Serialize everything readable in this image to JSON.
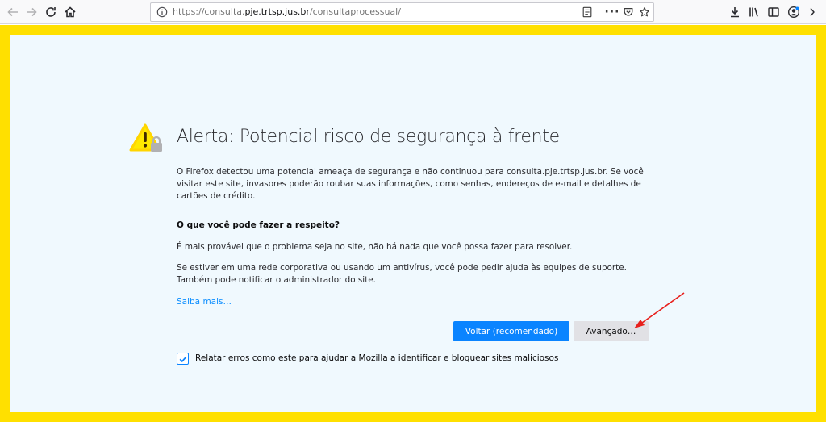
{
  "browser": {
    "url_prefix": "https://consulta.",
    "url_host": "pje.trtsp.jus.br",
    "url_path": "/consultaprocessual/",
    "icons": {
      "back": "arrow-left-icon",
      "forward": "arrow-right-icon",
      "reload": "reload-icon",
      "home": "home-icon",
      "info": "info-icon",
      "reader": "reader-view-icon",
      "more": "more-icon",
      "pocket": "pocket-icon",
      "bookmark": "star-icon",
      "downloads": "download-icon",
      "library": "library-icon",
      "sidebar": "sidebar-icon",
      "account": "account-icon"
    }
  },
  "error_page": {
    "title": "Alerta: Potencial risco de segurança à frente",
    "intro": "O Firefox detectou uma potencial ameaça de segurança e não continuou para consulta.pje.trtsp.jus.br. Se você visitar este site, invasores poderão roubar suas informações, como senhas, endereços de e-mail e detalhes de cartões de crédito.",
    "what_heading": "O que você pode fazer a respeito?",
    "para1": "É mais provável que o problema seja no site, não há nada que você possa fazer para resolver.",
    "para2": "Se estiver em uma rede corporativa ou usando um antivírus, você pode pedir ajuda às equipes de suporte. Também pode notificar o administrador do site.",
    "learn_more": "Saiba mais…",
    "go_back_button": "Voltar (recomendado)",
    "advanced_button": "Avançado…",
    "report_checkbox_label": "Relatar erros como este para ajudar a Mozilla a identificar e bloquear sites maliciosos",
    "report_checked": true
  },
  "colors": {
    "frame": "#ffe000",
    "page_bg": "#f0f9fe",
    "primary": "#0a84ff",
    "link": "#0a8dff",
    "annotation_arrow": "#e8201c"
  }
}
